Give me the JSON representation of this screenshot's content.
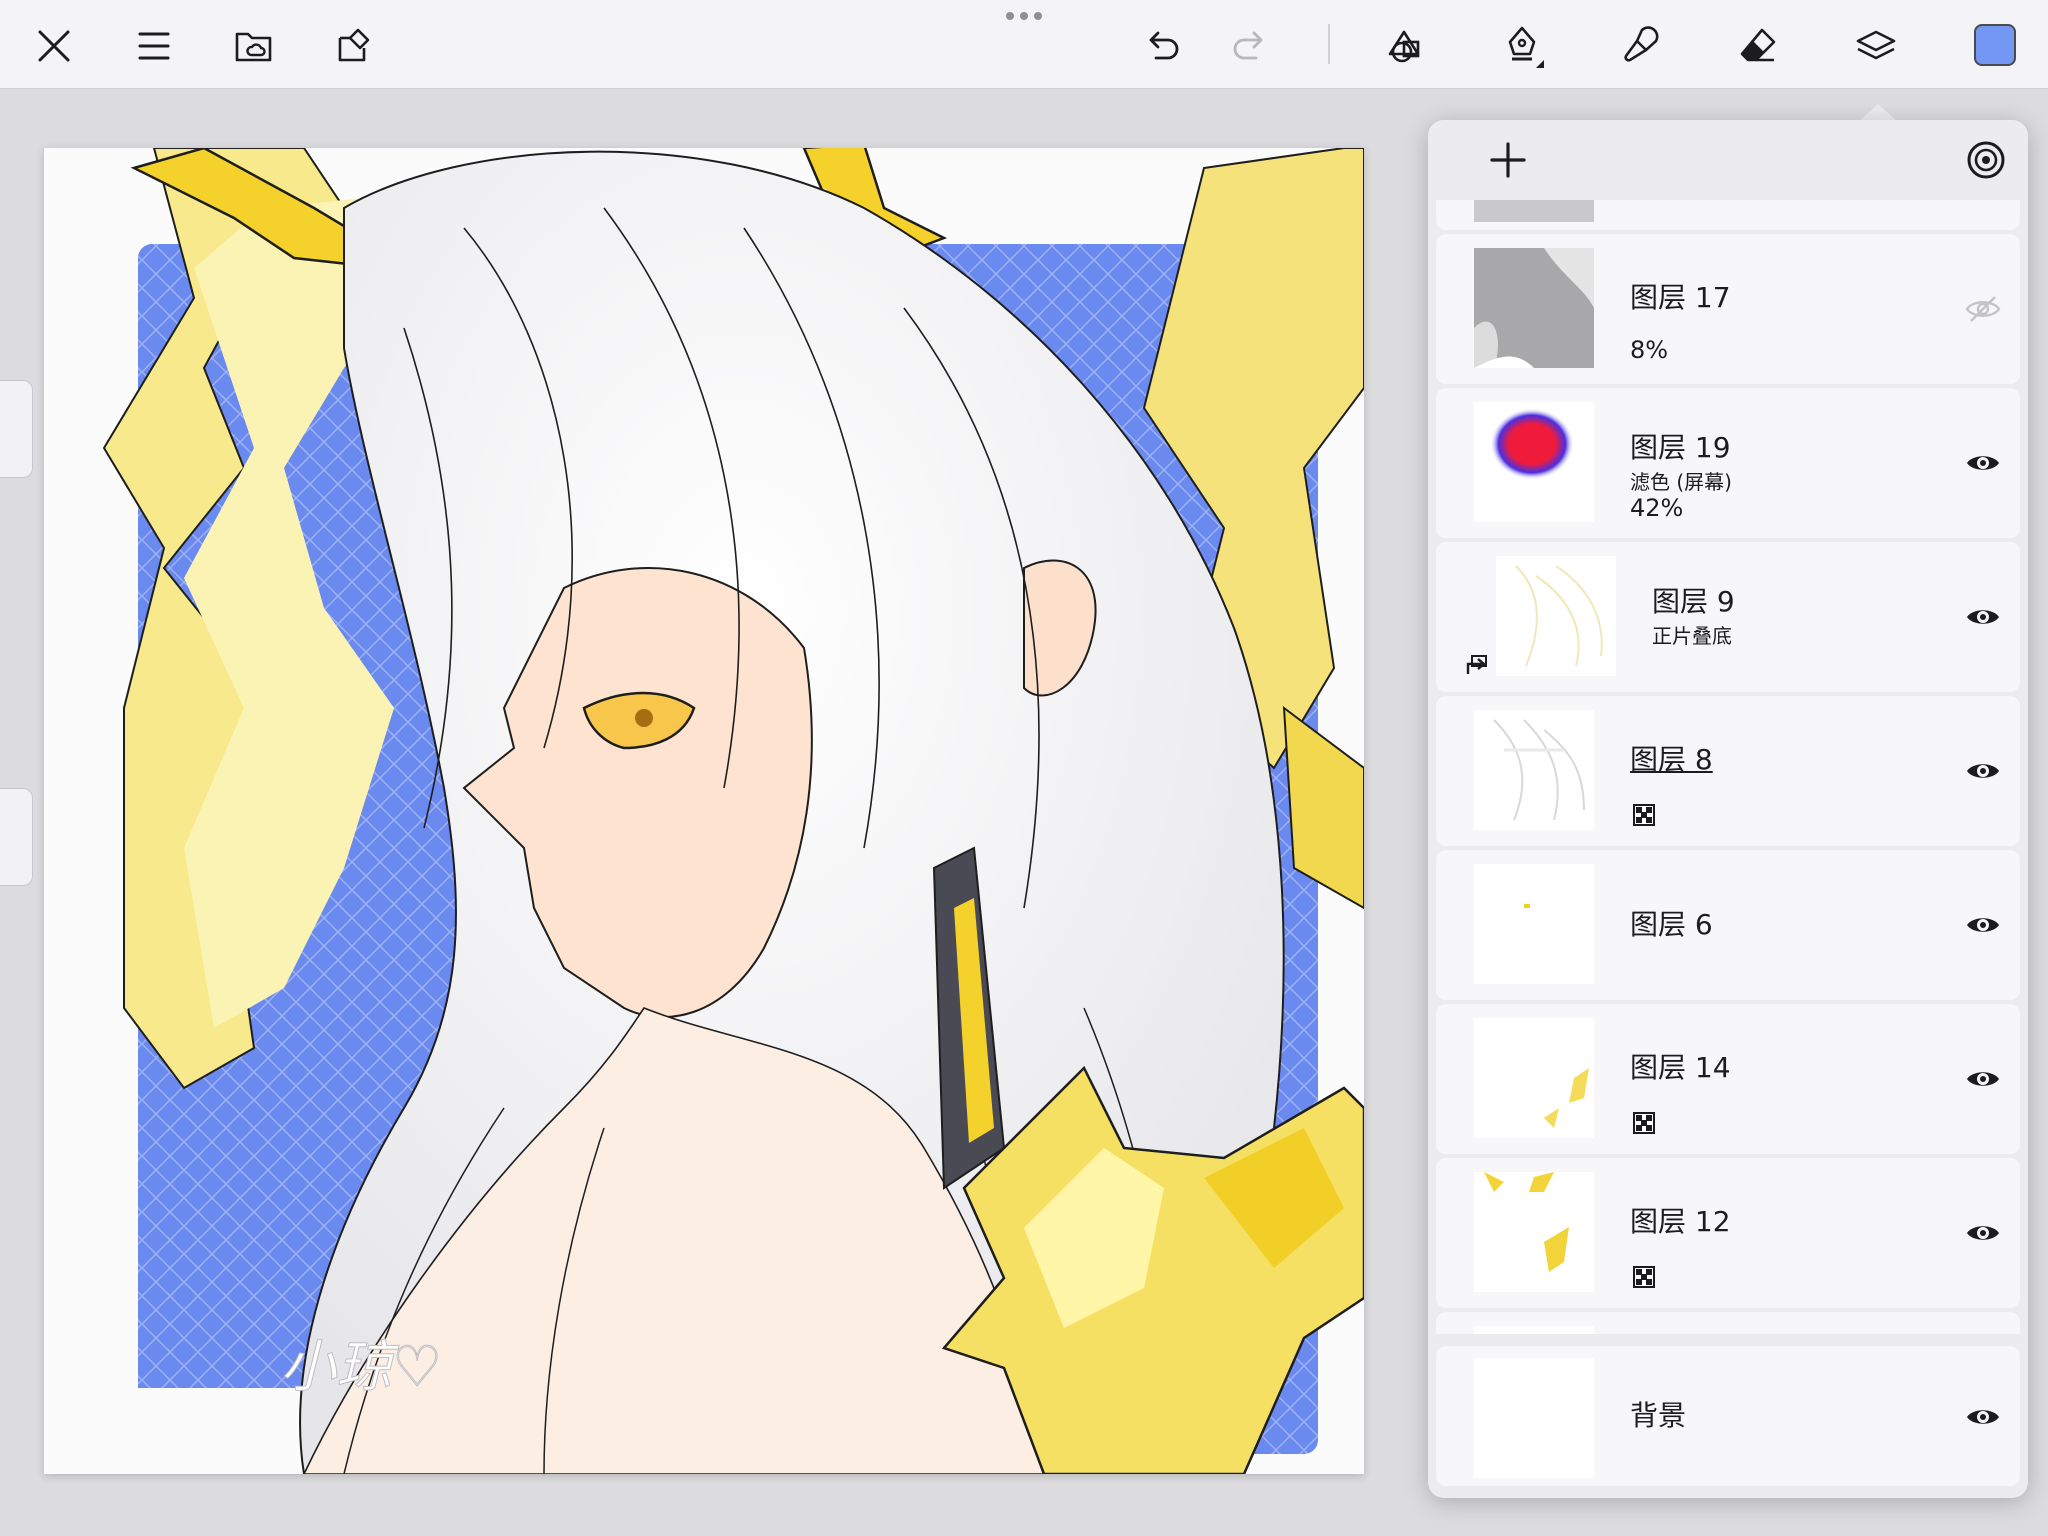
{
  "toolbar": {
    "left_icons": [
      "close-icon",
      "menu-icon",
      "folder-cloud-icon",
      "import-icon"
    ],
    "center_icons": [
      "more-dots-icon"
    ],
    "right_icons": [
      "undo-icon",
      "redo-icon",
      "adjust-shapes-icon",
      "pen-icon",
      "brush-icon",
      "eraser-icon",
      "layers-icon"
    ],
    "current_color": "#7397f3"
  },
  "canvas": {
    "signature": "小琼♡"
  },
  "layers_panel": {
    "header_icons": [
      "add-layer-icon",
      "layer-target-icon"
    ],
    "layers": [
      {
        "name": "图层 17",
        "opacity": "8%",
        "visible": false
      },
      {
        "name": "图层 19",
        "blend": "滤色 (屏幕)",
        "opacity": "42%",
        "visible": true
      },
      {
        "name": "图层 9",
        "blend": "正片叠底",
        "visible": true,
        "clipped": true
      },
      {
        "name": "图层 8",
        "visible": true,
        "alpha_lock": true,
        "selected": true
      },
      {
        "name": "图层 6",
        "visible": true
      },
      {
        "name": "图层 14",
        "visible": true,
        "alpha_lock": true
      },
      {
        "name": "图层 12",
        "visible": true,
        "alpha_lock": true
      },
      {
        "name": "背景",
        "visible": true
      }
    ]
  }
}
